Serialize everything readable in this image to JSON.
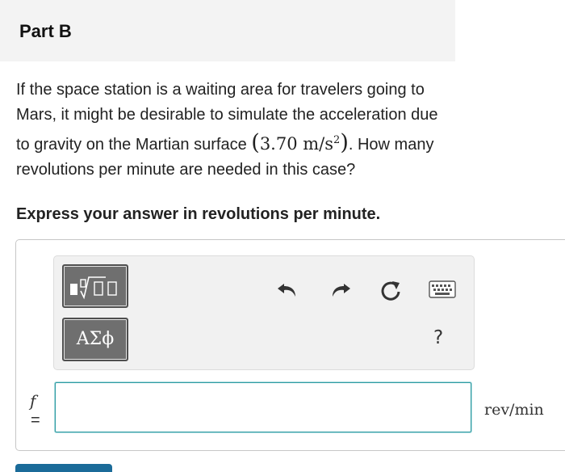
{
  "part": {
    "title": "Part B"
  },
  "question": {
    "text_before": "If the space station is a waiting area for travelers going to Mars, it might be desirable to simulate the acceleration due to gravity on the Martian surface",
    "math_value": "3.70",
    "math_unit": "m/s",
    "math_exponent": "2",
    "text_after": ". How many revolutions per minute are needed in this case?"
  },
  "instruction": "Express your answer in revolutions per minute.",
  "toolbar": {
    "templates_label": "templates",
    "symbols_label": "ΑΣϕ",
    "help_label": "?",
    "undo_icon": "undo-icon",
    "redo_icon": "redo-icon",
    "reset_icon": "reset-icon",
    "keyboard_icon": "keyboard-icon"
  },
  "answer": {
    "variable": "f",
    "equals": "=",
    "value": "",
    "unit": "rev/min"
  },
  "colors": {
    "header_bg": "#f3f3f3",
    "button_bg": "#6f6f6f",
    "input_border": "#2e9ba2",
    "submit": "#1b6b99"
  }
}
